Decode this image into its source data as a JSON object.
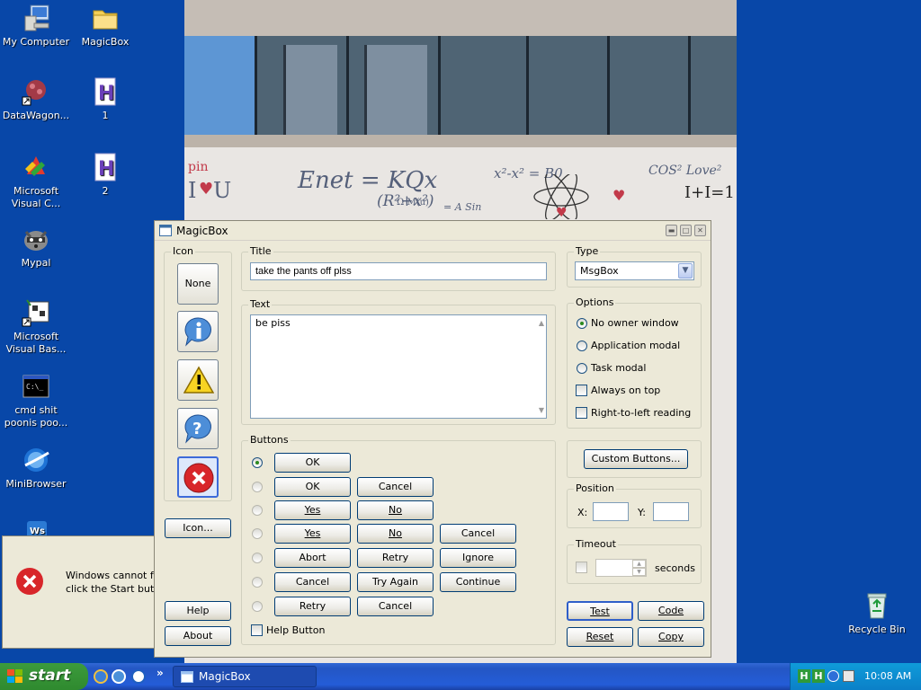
{
  "desktop": {
    "icons": [
      {
        "label": "My Computer",
        "glyph": "computer-icon"
      },
      {
        "label": "MagicBox",
        "glyph": "folder-icon"
      },
      {
        "label": "DataWagon...",
        "glyph": "datawagon-icon"
      },
      {
        "label": "1",
        "glyph": "h-document-icon"
      },
      {
        "label": "Microsoft Visual C...",
        "glyph": "visual-c-icon"
      },
      {
        "label": "2",
        "glyph": "h-document-icon"
      },
      {
        "label": "Mypal",
        "glyph": "raccoon-icon"
      },
      {
        "label": "Microsoft Visual Bas...",
        "glyph": "visual-basic-icon"
      },
      {
        "label": "cmd shit poonis poo...",
        "glyph": "cmd-icon"
      },
      {
        "label": "MiniBrowser",
        "glyph": "browser-icon"
      },
      {
        "label": "Recycle Bin",
        "glyph": "recycle-bin-icon"
      }
    ],
    "notice": {
      "line1": "Windows cannot f",
      "line2": "click the Start butt"
    }
  },
  "wallpaper": {
    "phrases": [
      "pin",
      "I",
      "U",
      "Enet = KQx",
      "(R²+x²)",
      "x²-x² = B0",
      "COS² Love²",
      "I+I=1",
      "Ω M(u)",
      "= A Sin"
    ]
  },
  "dialog": {
    "title": "MagicBox",
    "icon_group": {
      "label": "Icon",
      "none_label": "None",
      "icon_button": "Icon..."
    },
    "title_field": {
      "label": "Title",
      "value": "take the pants off plss"
    },
    "text_field": {
      "label": "Text",
      "value": "be piss"
    },
    "type": {
      "label": "Type",
      "selected": "MsgBox"
    },
    "options": {
      "label": "Options",
      "items": [
        "No owner window",
        "Application modal",
        "Task modal",
        "Always on top",
        "Right-to-left reading"
      ]
    },
    "buttons_group": {
      "label": "Buttons",
      "rows": [
        [
          "OK"
        ],
        [
          "OK",
          "Cancel"
        ],
        [
          "Yes",
          "No"
        ],
        [
          "Yes",
          "No",
          "Cancel"
        ],
        [
          "Abort",
          "Retry",
          "Ignore"
        ],
        [
          "Cancel",
          "Try Again",
          "Continue"
        ],
        [
          "Retry",
          "Cancel"
        ]
      ],
      "help_button": "Help Button"
    },
    "custom_buttons": "Custom Buttons...",
    "position": {
      "label": "Position",
      "x_label": "X:",
      "y_label": "Y:"
    },
    "timeout": {
      "label": "Timeout",
      "unit": "seconds"
    },
    "footer": {
      "help": "Help",
      "about": "About",
      "test": "Test",
      "code": "Code",
      "reset": "Reset",
      "copy": "Copy"
    }
  },
  "taskbar": {
    "start": "start",
    "chevron": "»",
    "task": "MagicBox",
    "clock": "10:08 AM"
  }
}
